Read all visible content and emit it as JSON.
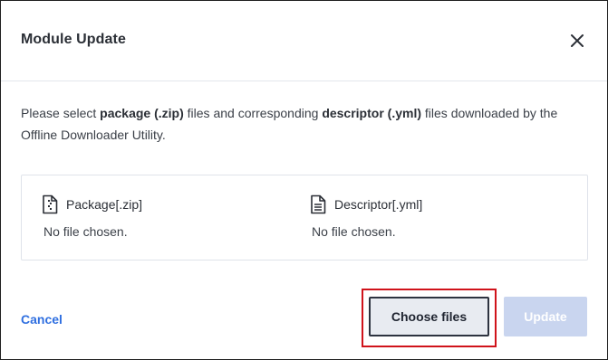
{
  "dialog": {
    "title": "Module Update",
    "close_icon": "close-icon"
  },
  "description": {
    "part1": "Please select ",
    "pkg_bold": "package (.zip)",
    "part2": " files and corresponding ",
    "desc_bold": "descriptor (.yml)",
    "part3": " files downloaded by the Offline Downloader Utility."
  },
  "files": {
    "package": {
      "icon": "zip-file-icon",
      "label": "Package[.zip]",
      "status": "No file chosen."
    },
    "descriptor": {
      "icon": "document-file-icon",
      "label": "Descriptor[.yml]",
      "status": "No file chosen."
    }
  },
  "footer": {
    "cancel_label": "Cancel",
    "choose_label": "Choose files",
    "update_label": "Update",
    "colors": {
      "link": "#2f6fe0",
      "highlight": "#d0131b",
      "update_disabled": "#c9d5ef"
    }
  }
}
